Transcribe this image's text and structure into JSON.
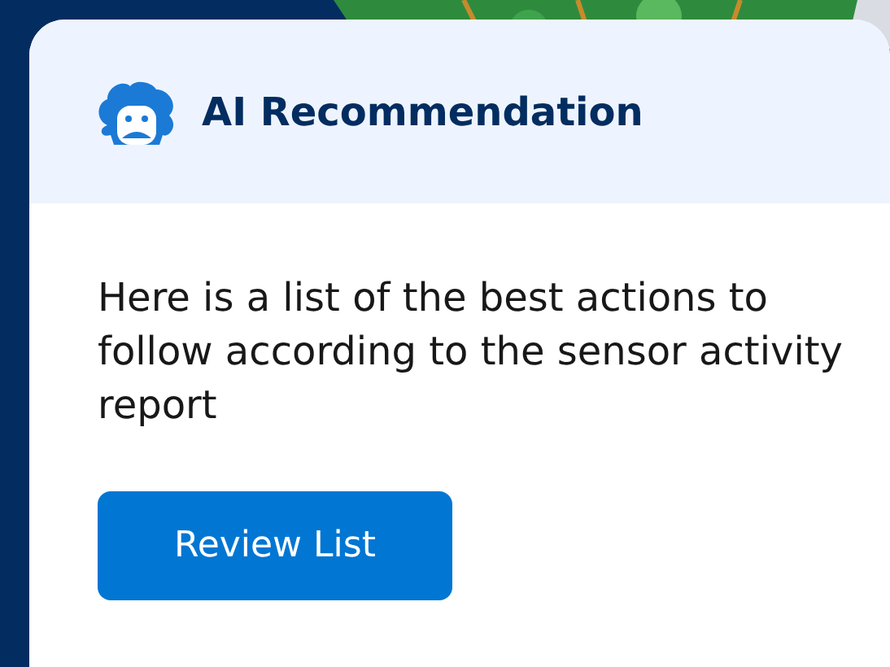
{
  "card": {
    "title": "AI Recommendation",
    "message": "Here is a list of the best actions to follow according to the sensor activity report",
    "button": "Review List"
  }
}
